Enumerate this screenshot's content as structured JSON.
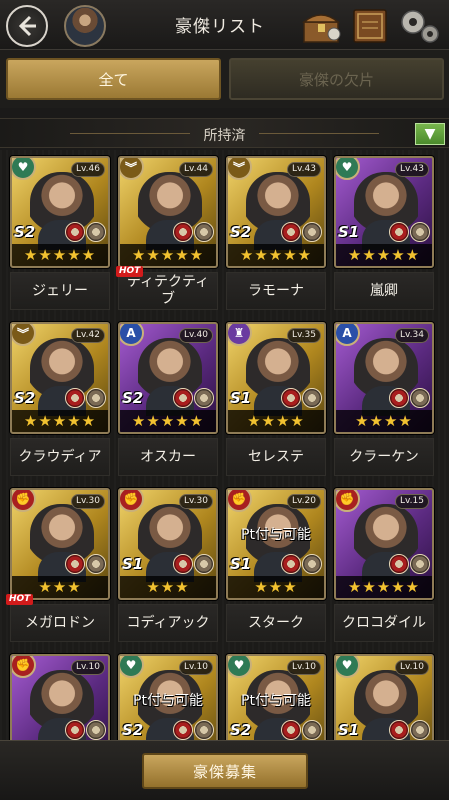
{
  "header": {
    "title": "豪傑リスト"
  },
  "tabs": [
    {
      "label": "全て",
      "active": true
    },
    {
      "label": "豪傑の欠片",
      "active": false
    }
  ],
  "section": {
    "label": "所持済"
  },
  "heroes": [
    {
      "name": "ジェリー",
      "level": "Lv.46",
      "grade": "S2",
      "stars": "★★★★★",
      "frame": "gold",
      "role": "green",
      "hot": false,
      "pt": ""
    },
    {
      "name": "ティテクティブ",
      "level": "Lv.44",
      "grade": "",
      "stars": "★★★★★",
      "frame": "gold",
      "role": "gold",
      "hot": true,
      "pt": ""
    },
    {
      "name": "ラモーナ",
      "level": "Lv.43",
      "grade": "S2",
      "stars": "★★★★★",
      "frame": "gold",
      "role": "gold",
      "hot": false,
      "pt": ""
    },
    {
      "name": "嵐卿",
      "level": "Lv.43",
      "grade": "S1",
      "stars": "★★★★★",
      "frame": "purple",
      "role": "green",
      "hot": false,
      "pt": ""
    },
    {
      "name": "クラウディア",
      "level": "Lv.42",
      "grade": "S2",
      "stars": "★★★★★",
      "frame": "gold",
      "role": "gold",
      "hot": false,
      "pt": ""
    },
    {
      "name": "オスカー",
      "level": "Lv.40",
      "grade": "S2",
      "stars": "★★★★★",
      "frame": "purple",
      "role": "blue",
      "hot": false,
      "pt": ""
    },
    {
      "name": "セレステ",
      "level": "Lv.35",
      "grade": "S1",
      "stars": "★★★★",
      "frame": "gold",
      "role": "purple",
      "hot": false,
      "pt": ""
    },
    {
      "name": "クラーケン",
      "level": "Lv.34",
      "grade": "",
      "stars": "★★★★",
      "frame": "purple",
      "role": "blue",
      "hot": false,
      "pt": ""
    },
    {
      "name": "メガロドン",
      "level": "Lv.30",
      "grade": "",
      "stars": "★★★",
      "frame": "gold",
      "role": "red",
      "hot": true,
      "pt": ""
    },
    {
      "name": "コディアック",
      "level": "Lv.30",
      "grade": "S1",
      "stars": "★★★",
      "frame": "gold",
      "role": "red",
      "hot": false,
      "pt": ""
    },
    {
      "name": "スターク",
      "level": "Lv.20",
      "grade": "S1",
      "stars": "★★★",
      "frame": "gold",
      "role": "red",
      "hot": false,
      "pt": "Pt付与可能"
    },
    {
      "name": "クロコダイル",
      "level": "Lv.15",
      "grade": "",
      "stars": "★★★★★",
      "frame": "purple",
      "role": "red",
      "hot": false,
      "pt": ""
    },
    {
      "name": "",
      "level": "Lv.10",
      "grade": "",
      "stars": "",
      "frame": "purple",
      "role": "red",
      "hot": false,
      "pt": ""
    },
    {
      "name": "",
      "level": "Lv.10",
      "grade": "S2",
      "stars": "",
      "frame": "gold",
      "role": "green",
      "hot": false,
      "pt": "Pt付与可能"
    },
    {
      "name": "",
      "level": "Lv.10",
      "grade": "S2",
      "stars": "",
      "frame": "gold",
      "role": "green",
      "hot": false,
      "pt": "Pt付与可能"
    },
    {
      "name": "",
      "level": "Lv.10",
      "grade": "S1",
      "stars": "",
      "frame": "gold",
      "role": "green",
      "hot": false,
      "pt": ""
    }
  ],
  "hot_badge": "HOT",
  "footer": {
    "recruit_label": "豪傑募集"
  },
  "icons": {
    "back": "back-arrow-icon",
    "toggle": "triangle-down-icon"
  }
}
